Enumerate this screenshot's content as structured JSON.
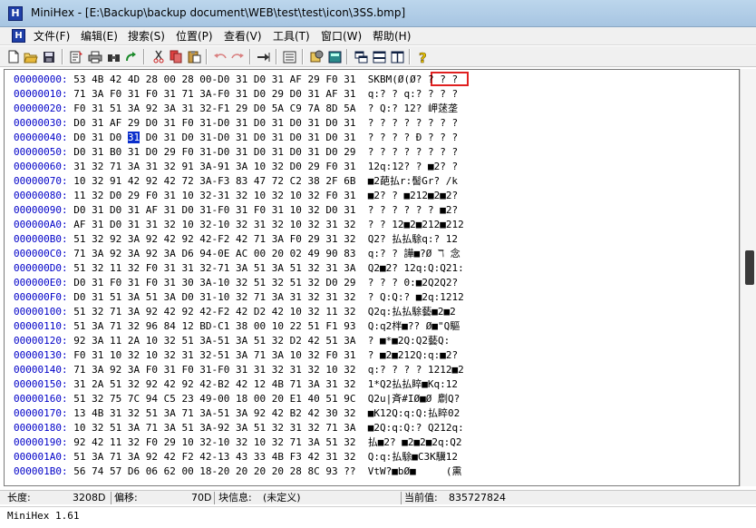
{
  "window": {
    "title": "MiniHex - [E:\\Backup\\backup document\\WEB\\test\\test\\icon\\3SS.bmp]"
  },
  "menu": [
    {
      "label": "文件(F)"
    },
    {
      "label": "编辑(E)"
    },
    {
      "label": "搜索(S)"
    },
    {
      "label": "位置(P)"
    },
    {
      "label": "查看(V)"
    },
    {
      "label": "工具(T)"
    },
    {
      "label": "窗口(W)"
    },
    {
      "label": "帮助(H)"
    }
  ],
  "toolbar": {
    "buttons": [
      {
        "icon": "new-file-icon"
      },
      {
        "icon": "open-folder-icon"
      },
      {
        "icon": "save-icon"
      },
      {
        "icon": "properties-icon"
      },
      {
        "icon": "print-icon"
      },
      {
        "icon": "find-icon"
      },
      {
        "icon": "find-next-icon"
      },
      {
        "icon": "cut-icon"
      },
      {
        "icon": "copy-icon"
      },
      {
        "icon": "paste-icon"
      },
      {
        "icon": "undo-icon"
      },
      {
        "icon": "redo-icon"
      },
      {
        "icon": "goto-icon"
      },
      {
        "icon": "notepad-icon"
      },
      {
        "icon": "tools-icon"
      },
      {
        "icon": "calculator-icon"
      },
      {
        "icon": "cascade-windows-icon"
      },
      {
        "icon": "tile-horizontal-icon"
      },
      {
        "icon": "tile-vertical-icon"
      },
      {
        "icon": "help-icon"
      }
    ]
  },
  "hex": {
    "rows": [
      {
        "addr": "00000000:",
        "hex": "53 4B 42 4D 28 00 28 00-D0 31 D0 31 AF 29 F0 31",
        "ascii": "SKBM(Ø(Ø? ? ? ?"
      },
      {
        "addr": "00000010:",
        "hex": "71 3A F0 31 F0 31 71 3A-F0 31 D0 29 D0 31 AF 31",
        "ascii": "q:? ? q:? ? ? ?"
      },
      {
        "addr": "00000020:",
        "hex": "F0 31 51 3A 92 3A 31 32-F1 29 D0 5A C9 7A 8D 5A",
        "ascii": "? Q:? 12? 岬蒁垄"
      },
      {
        "addr": "00000030:",
        "hex": "D0 31 AF 29 D0 31 F0 31-D0 31 D0 31 D0 31 D0 31",
        "ascii": "? ? ? ? ? ? ? ?"
      },
      {
        "addr": "00000040:",
        "hex": "D0 31 D0 31 D0 31 D0 31-D0 31 D0 31 D0 31 D0 31",
        "ascii": "? ? ? ? Ð ? ? ?"
      },
      {
        "addr": "00000050:",
        "hex": "D0 31 B0 31 D0 29 F0 31-D0 31 D0 31 D0 31 D0 29",
        "ascii": "? ? ? ? ? ? ? ?"
      },
      {
        "addr": "00000060:",
        "hex": "31 32 71 3A 31 32 91 3A-91 3A 10 32 D0 29 F0 31",
        "ascii": "12q:12? ? ■2? ?"
      },
      {
        "addr": "00000070:",
        "hex": "10 32 91 42 92 42 72 3A-F3 83 47 72 C2 38 2F 6B",
        "ascii": "■2葩払r:髻Gr? /k"
      },
      {
        "addr": "00000080:",
        "hex": "11 32 D0 29 F0 31 10 32-31 32 10 32 10 32 F0 31",
        "ascii": "■2? ? ■212■2■2?"
      },
      {
        "addr": "00000090:",
        "hex": "D0 31 D0 31 AF 31 D0 31-F0 31 F0 31 10 32 D0 31",
        "ascii": "? ? ? ? ? ? ■2?"
      },
      {
        "addr": "000000A0:",
        "hex": "AF 31 D0 31 31 32 10 32-10 32 31 32 10 32 31 32",
        "ascii": "? ? 12■2■212■212"
      },
      {
        "addr": "000000B0:",
        "hex": "51 32 92 3A 92 42 92 42-F2 42 71 3A F0 29 31 32",
        "ascii": "Q2? 払払駼q:? 12"
      },
      {
        "addr": "000000C0:",
        "hex": "71 3A 92 3A 92 3A D6 94-0E AC 00 20 02 49 90 83",
        "ascii": "q:? ? 譁■?Ø ℸ 念"
      },
      {
        "addr": "000000D0:",
        "hex": "51 32 11 32 F0 31 31 32-71 3A 51 3A 51 32 31 3A",
        "ascii": "Q2■2? 12q:Q:Q21:"
      },
      {
        "addr": "000000E0:",
        "hex": "D0 31 F0 31 F0 31 30 3A-10 32 51 32 51 32 D0 29",
        "ascii": "? ? ? 0:■2Q2Q2?"
      },
      {
        "addr": "000000F0:",
        "hex": "D0 31 51 3A 51 3A D0 31-10 32 71 3A 31 32 31 32",
        "ascii": "? Q:Q:? ■2q:1212"
      },
      {
        "addr": "00000100:",
        "hex": "51 32 71 3A 92 42 92 42-F2 42 D2 42 10 32 11 32",
        "ascii": "Q2q:払払駼藝■2■2"
      },
      {
        "addr": "00000110:",
        "hex": "51 3A 71 32 96 84 12 BD-C1 38 00 10 22 51 F1 93",
        "ascii": "Q:q2柈■?? Ø■\"Q驅"
      },
      {
        "addr": "00000120:",
        "hex": "92 3A 11 2A 10 32 51 3A-51 3A 51 32 D2 42 51 3A",
        "ascii": "? ■*■2Q:Q2藝Q:"
      },
      {
        "addr": "00000130:",
        "hex": "F0 31 10 32 10 32 31 32-51 3A 71 3A 10 32 F0 31",
        "ascii": "? ■2■212Q:q:■2?"
      },
      {
        "addr": "00000140:",
        "hex": "71 3A 92 3A F0 31 F0 31-F0 31 31 32 31 32 10 32",
        "ascii": "q:? ? ? ? 1212■2"
      },
      {
        "addr": "00000150:",
        "hex": "31 2A 51 32 92 42 92 42-B2 42 12 4B 71 3A 31 32",
        "ascii": "1*Q2払払睟■Kq:12"
      },
      {
        "addr": "00000160:",
        "hex": "51 32 75 7C 94 C5 23 49-00 18 00 20 E1 40 51 9C",
        "ascii": "Q2u|斉#IØ■Ø 劘Q?"
      },
      {
        "addr": "00000170:",
        "hex": "13 4B 31 32 51 3A 71 3A-51 3A 92 42 B2 42 30 32",
        "ascii": "■K12Q:q:Q:払睟02"
      },
      {
        "addr": "00000180:",
        "hex": "10 32 51 3A 71 3A 51 3A-92 3A 51 32 31 32 71 3A",
        "ascii": "■2Q:q:Q:? Q212q:"
      },
      {
        "addr": "00000190:",
        "hex": "92 42 11 32 F0 29 10 32-10 32 10 32 71 3A 51 32",
        "ascii": "払■2? ■2■2■2q:Q2"
      },
      {
        "addr": "000001A0:",
        "hex": "51 3A 71 3A 92 42 F2 42-13 43 33 4B F3 42 31 32",
        "ascii": "Q:q:払駼■C3K驥12"
      },
      {
        "addr": "000001B0:",
        "hex": "56 74 57 D6 06 62 00 18-20 20 20 20 28 8C 93 ??",
        "ascii": "VtW?■bØ■     (熏"
      }
    ]
  },
  "status": {
    "length_label": "长度:",
    "length_value": "3208D",
    "offset_label": "偏移:",
    "offset_value": "70D",
    "block_label": "块信息:",
    "block_value": "(未定义)",
    "position_label": "当前值:",
    "position_value": "835727824"
  },
  "footer": {
    "text": "MiniHex 1.61"
  }
}
